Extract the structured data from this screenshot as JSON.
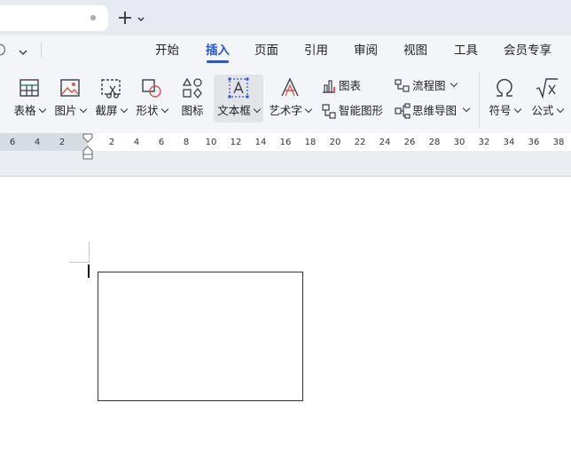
{
  "tabbar": {
    "new_tab_symbol": "+",
    "icons": [
      "close-dot-icon",
      "plus-icon",
      "chevron-down-icon"
    ]
  },
  "menu": {
    "items": [
      "开始",
      "插入",
      "页面",
      "引用",
      "审阅",
      "视图",
      "工具",
      "会员专享"
    ],
    "active": "插入",
    "left_icons": [
      "redo-icon",
      "chevron-down-icon"
    ]
  },
  "ribbon": {
    "table": "表格",
    "picture": "图片",
    "screenshot": "截屏",
    "shape": "形状",
    "icon": "图标",
    "textbox": "文本框",
    "wordart": "艺术字",
    "chart": "图表",
    "smartart": "智能图形",
    "flowchart": "流程图",
    "mindmap": "思维导图",
    "symbol": "符号",
    "formula": "公式",
    "selected": "文本框"
  },
  "ruler": {
    "left_labels": [
      "6",
      "4",
      "2"
    ],
    "right_labels": [
      "2",
      "4",
      "6",
      "8",
      "10",
      "12",
      "14",
      "16",
      "18",
      "20",
      "22",
      "24",
      "26",
      "28",
      "30",
      "32",
      "34",
      "36",
      "38"
    ]
  },
  "colors": {
    "accent": "#2456d6",
    "tabstrip": "#e7eaf0",
    "ribbon": "#f3f5f9",
    "selected_bg": "#e2e4e8",
    "icon_stroke": "#3a3f47",
    "icon_red": "#e0524a"
  }
}
